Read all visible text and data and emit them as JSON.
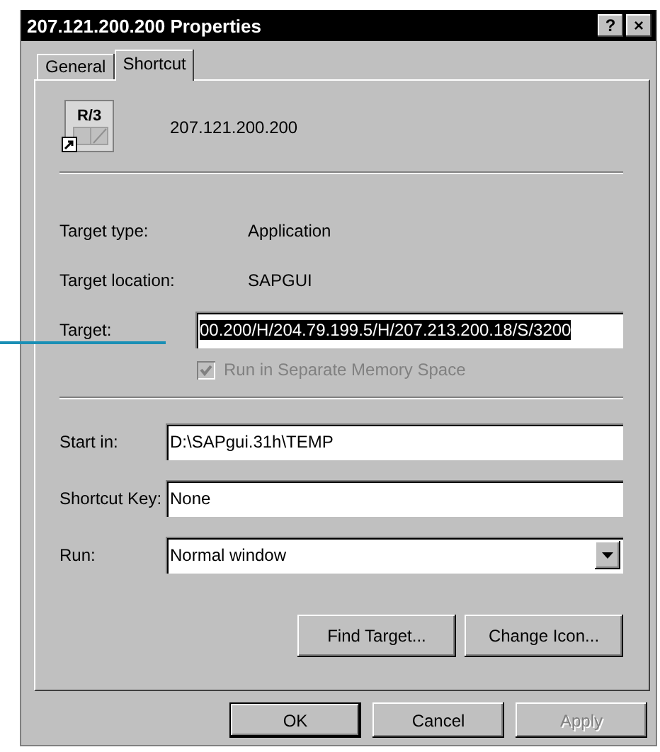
{
  "window": {
    "title": "207.121.200.200 Properties",
    "help_button": "?",
    "close_button": "×"
  },
  "tabs": [
    {
      "label": "General",
      "selected": false
    },
    {
      "label": "Shortcut",
      "selected": true
    }
  ],
  "shortcut": {
    "name": "207.121.200.200",
    "icon_label": "R/3",
    "info": [
      {
        "label": "Target type:",
        "value": "Application"
      },
      {
        "label": "Target location:",
        "value": "SAPGUI"
      }
    ],
    "target": {
      "label": "Target:",
      "value": "00.200/H/204.79.199.5/H/207.213.200.18/S/3200",
      "selected": true
    },
    "separate_memory": {
      "label": "Run in Separate Memory Space",
      "checked": true,
      "disabled": true
    },
    "fields": [
      {
        "kind": "text",
        "label": "Start in:",
        "value": "D:\\SAPgui.31h\\TEMP"
      },
      {
        "kind": "text",
        "label": "Shortcut Key:",
        "value": "None"
      },
      {
        "kind": "dropdown",
        "label": "Run:",
        "value": "Normal window"
      }
    ],
    "buttons": [
      {
        "label": "Find Target..."
      },
      {
        "label": "Change Icon..."
      }
    ]
  },
  "footer_buttons": [
    {
      "label": "OK",
      "default": true,
      "disabled": false
    },
    {
      "label": "Cancel",
      "default": false,
      "disabled": false
    },
    {
      "label": "Apply",
      "default": false,
      "disabled": true
    }
  ]
}
